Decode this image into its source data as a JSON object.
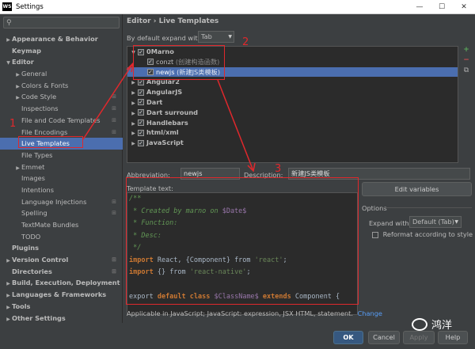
{
  "window": {
    "title": "Settings",
    "app_icon": "WS",
    "controls": [
      "—",
      "☐",
      "✕"
    ]
  },
  "search": {
    "placeholder": ""
  },
  "nav": [
    {
      "label": "Appearance & Behavior",
      "bold": true,
      "arrow": "▶",
      "indent": 0
    },
    {
      "label": "Keymap",
      "bold": true,
      "arrow": "",
      "indent": 0
    },
    {
      "label": "Editor",
      "bold": true,
      "arrow": "▼",
      "indent": 0
    },
    {
      "label": "General",
      "bold": false,
      "arrow": "▶",
      "indent": 1
    },
    {
      "label": "Colors & Fonts",
      "bold": false,
      "arrow": "▶",
      "indent": 1
    },
    {
      "label": "Code Style",
      "bold": false,
      "arrow": "▶",
      "indent": 1,
      "page_icon": true
    },
    {
      "label": "Inspections",
      "bold": false,
      "arrow": "",
      "indent": 1,
      "page_icon": true
    },
    {
      "label": "File and Code Templates",
      "bold": false,
      "arrow": "",
      "indent": 1,
      "page_icon": true
    },
    {
      "label": "File Encodings",
      "bold": false,
      "arrow": "",
      "indent": 1,
      "page_icon": true
    },
    {
      "label": "Live Templates",
      "bold": false,
      "arrow": "",
      "indent": 1,
      "selected": true
    },
    {
      "label": "File Types",
      "bold": false,
      "arrow": "",
      "indent": 1
    },
    {
      "label": "Emmet",
      "bold": false,
      "arrow": "▶",
      "indent": 1
    },
    {
      "label": "Images",
      "bold": false,
      "arrow": "",
      "indent": 1
    },
    {
      "label": "Intentions",
      "bold": false,
      "arrow": "",
      "indent": 1
    },
    {
      "label": "Language Injections",
      "bold": false,
      "arrow": "",
      "indent": 1,
      "page_icon": true
    },
    {
      "label": "Spelling",
      "bold": false,
      "arrow": "",
      "indent": 1,
      "page_icon": true
    },
    {
      "label": "TextMate Bundles",
      "bold": false,
      "arrow": "",
      "indent": 1
    },
    {
      "label": "TODO",
      "bold": false,
      "arrow": "",
      "indent": 1
    },
    {
      "label": "Plugins",
      "bold": true,
      "arrow": "",
      "indent": 0
    },
    {
      "label": "Version Control",
      "bold": true,
      "arrow": "▶",
      "indent": 0,
      "page_icon": true
    },
    {
      "label": "Directories",
      "bold": true,
      "arrow": "",
      "indent": 0,
      "page_icon": true
    },
    {
      "label": "Build, Execution, Deployment",
      "bold": true,
      "arrow": "▶",
      "indent": 0
    },
    {
      "label": "Languages & Frameworks",
      "bold": true,
      "arrow": "▶",
      "indent": 0
    },
    {
      "label": "Tools",
      "bold": true,
      "arrow": "▶",
      "indent": 0
    },
    {
      "label": "Other Settings",
      "bold": true,
      "arrow": "▶",
      "indent": 0
    }
  ],
  "breadcrumb": "Editor › Live Templates",
  "expand": {
    "label": "By default expand with",
    "value": "Tab"
  },
  "templates": [
    {
      "label": "0Marno",
      "bold": true,
      "arrow": "▼",
      "indent": 0,
      "checked": true,
      "desc": ""
    },
    {
      "label": "conzt",
      "bold": false,
      "arrow": "",
      "indent": 1,
      "checked": true,
      "desc": "(创建构造函数)"
    },
    {
      "label": "newjs",
      "bold": false,
      "arrow": "",
      "indent": 1,
      "checked": true,
      "desc": "(新建JS类模板)",
      "selected": true
    },
    {
      "label": "Angular2",
      "bold": true,
      "arrow": "▶",
      "indent": 0,
      "checked": true,
      "desc": ""
    },
    {
      "label": "AngularJS",
      "bold": true,
      "arrow": "▶",
      "indent": 0,
      "checked": true,
      "desc": ""
    },
    {
      "label": "Dart",
      "bold": true,
      "arrow": "▶",
      "indent": 0,
      "checked": true,
      "desc": ""
    },
    {
      "label": "Dart surround",
      "bold": true,
      "arrow": "▶",
      "indent": 0,
      "checked": true,
      "desc": ""
    },
    {
      "label": "Handlebars",
      "bold": true,
      "arrow": "▶",
      "indent": 0,
      "checked": true,
      "desc": ""
    },
    {
      "label": "html/xml",
      "bold": true,
      "arrow": "▶",
      "indent": 0,
      "checked": true,
      "desc": ""
    },
    {
      "label": "JavaScript",
      "bold": true,
      "arrow": "▶",
      "indent": 0,
      "checked": true,
      "desc": ""
    }
  ],
  "side_buttons": [
    "+",
    "−",
    "⧉"
  ],
  "abbreviation": {
    "label": "Abbreviation:",
    "value": "newjs"
  },
  "description": {
    "label": "Description:",
    "value": "新建JS类模板"
  },
  "template_text_label": "Template text:",
  "code": [
    [
      [
        "c-com",
        "/**"
      ]
    ],
    [
      [
        "c-com",
        " * Created by marno on "
      ],
      [
        "c-var",
        "$Date$"
      ]
    ],
    [
      [
        "c-com",
        " * Function:"
      ]
    ],
    [
      [
        "c-com",
        " * Desc:"
      ]
    ],
    [
      [
        "c-com",
        " */"
      ]
    ],
    [
      [
        "c-kw",
        "import"
      ],
      [
        "c-txt",
        " React, {Component} from "
      ],
      [
        "c-str",
        "'react'"
      ],
      [
        "c-txt",
        ";"
      ]
    ],
    [
      [
        "c-kw",
        "import"
      ],
      [
        "c-txt",
        " {} from "
      ],
      [
        "c-str",
        "'react-native'"
      ],
      [
        "c-txt",
        ";"
      ]
    ],
    [
      [
        "c-txt",
        ""
      ]
    ],
    [
      [
        "c-txt",
        "export "
      ],
      [
        "c-kw",
        "default"
      ],
      [
        "c-txt",
        " "
      ],
      [
        "c-kw",
        "class"
      ],
      [
        "c-txt",
        " "
      ],
      [
        "c-var",
        "$ClassName$"
      ],
      [
        "c-txt",
        " "
      ],
      [
        "c-kw",
        "extends"
      ],
      [
        "c-txt",
        " Component {"
      ]
    ],
    [
      [
        "c-txt",
        ""
      ]
    ],
    [
      [
        "c-txt",
        "}"
      ]
    ]
  ],
  "edit_variables": "Edit variables",
  "options": {
    "label": "Options",
    "expand_with_label": "Expand with",
    "expand_with_value": "Default (Tab)",
    "reformat_label": "Reformat according to style"
  },
  "applicable": {
    "text": "Applicable in JavaScript; JavaScript: expression, JSX HTML, statement.",
    "link": "Change"
  },
  "buttons": {
    "ok": "OK",
    "cancel": "Cancel",
    "apply": "Apply",
    "help": "Help"
  },
  "annotations": [
    "1",
    "2",
    "3"
  ],
  "watermark": "鸿洋",
  "colors": {
    "accent": "#4b6eaf",
    "annotation": "#e0282c",
    "bg": "#3c3f41"
  }
}
